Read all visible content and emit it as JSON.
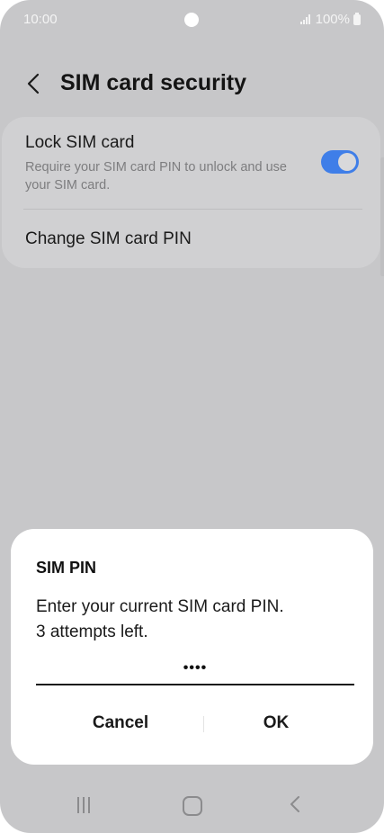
{
  "status_bar": {
    "time": "10:00",
    "battery_text": "100%",
    "icons": [
      "signal-icon",
      "battery-icon"
    ]
  },
  "header": {
    "title": "SIM card security",
    "back_icon": "chevron-left-icon"
  },
  "settings": {
    "lock_sim": {
      "label": "Lock SIM card",
      "description": "Require your SIM card PIN to unlock and use your SIM card.",
      "enabled": true
    },
    "change_pin": {
      "label": "Change SIM card PIN"
    }
  },
  "dialog": {
    "title": "SIM PIN",
    "message_line1": "Enter your current SIM card PIN.",
    "message_line2": "3 attempts left.",
    "pin_value": "••••",
    "cancel_label": "Cancel",
    "ok_label": "OK"
  },
  "nav_bar": {
    "icons": [
      "recent-apps-icon",
      "home-icon",
      "back-icon"
    ]
  },
  "colors": {
    "accent": "#3f7ee8",
    "background_dimmed": "#c7c7c9",
    "card": "#d0d0d2",
    "dialog": "#ffffff"
  }
}
